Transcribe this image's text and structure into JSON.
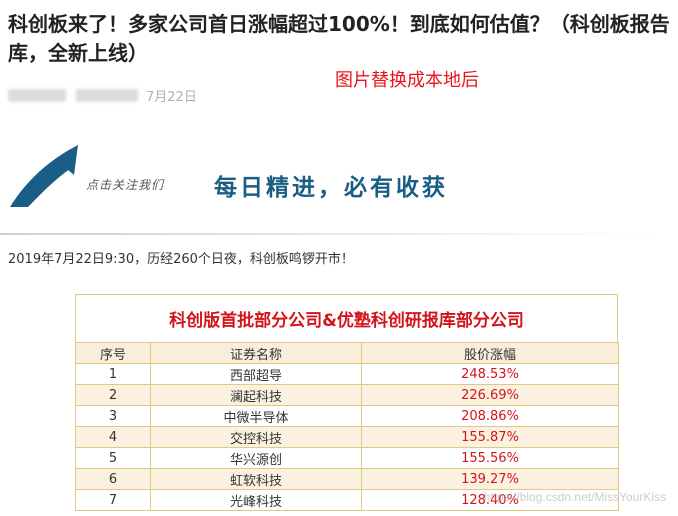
{
  "article": {
    "title": "科创板来了！多家公司首日涨幅超过100%！到底如何估值？（科创板报告库，全新上线）",
    "date": "7月22日",
    "overlay_note": "图片替换成本地后",
    "intro": "2019年7月22日9:30，历经260个日夜，科创板鸣锣开市！"
  },
  "banner": {
    "follow_text": "点击关注我们",
    "slogan": "每日精进，必有收获",
    "colors": {
      "accent": "#1a5e86",
      "arrow": "#1a5e86"
    },
    "icon": "arrow-icon"
  },
  "table": {
    "caption": "科创版首批部分公司&优塾科创研报库部分公司",
    "headers": [
      "序号",
      "证券名称",
      "股价涨幅"
    ],
    "rows": [
      [
        "1",
        "西部超导",
        "248.53%"
      ],
      [
        "2",
        "澜起科技",
        "226.69%"
      ],
      [
        "3",
        "中微半导体",
        "208.86%"
      ],
      [
        "4",
        "交控科技",
        "155.87%"
      ],
      [
        "5",
        "华兴源创",
        "155.56%"
      ],
      [
        "6",
        "虹软科技",
        "139.27%"
      ],
      [
        "7",
        "光峰科技",
        "128.40%"
      ]
    ],
    "colors": {
      "border": "#e0c980",
      "header_bg": "#f9eddc",
      "alt_bg": "#fbf1e0",
      "highlight": "#d4141c"
    }
  },
  "watermark": "https://blog.csdn.net/MissYourKiss"
}
